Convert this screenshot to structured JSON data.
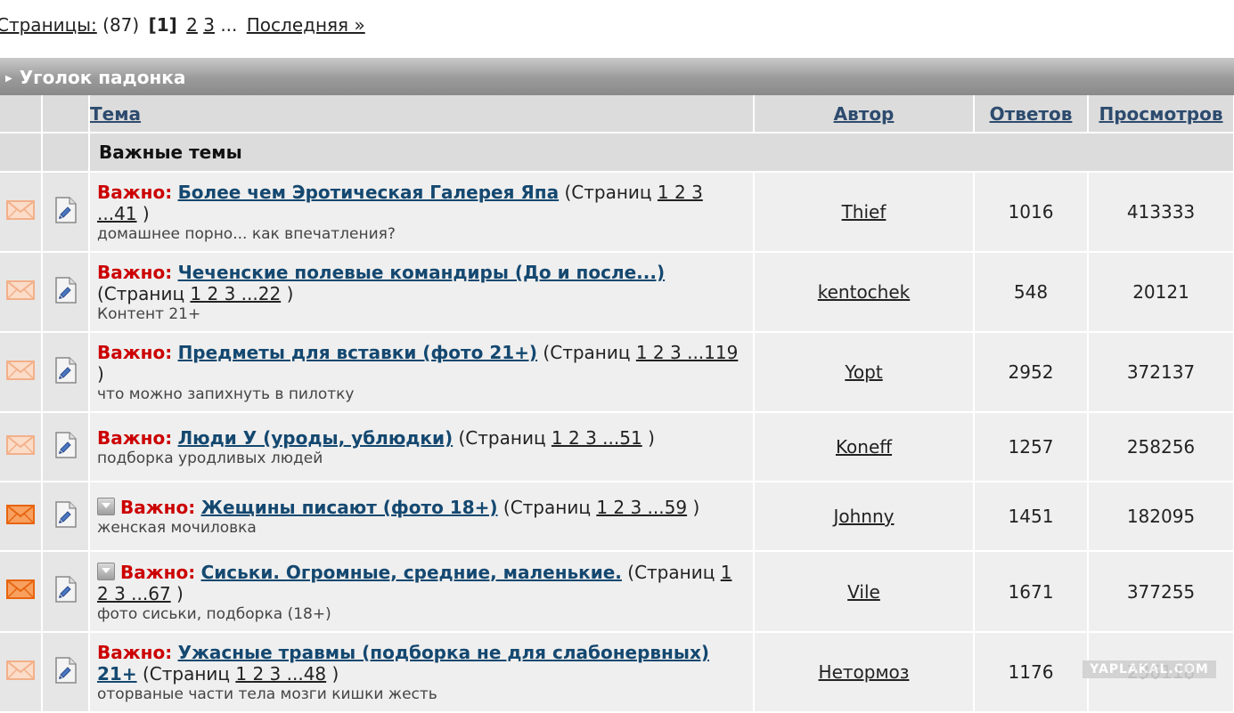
{
  "pager": {
    "label": "Страницы:",
    "count": "(87)",
    "current": "[1]",
    "p2": "2",
    "p3": "3",
    "ellipsis": "...",
    "last": "Последняя »"
  },
  "forum": {
    "title": "Уголок падонка"
  },
  "columns": {
    "topic": "Тема",
    "author": "Автор",
    "replies": "Ответов",
    "views": "Просмотров"
  },
  "section": {
    "label": "Важные темы"
  },
  "important_label": "Важно:",
  "pages_word": "(Страниц",
  "close_paren": ")",
  "topics": [
    {
      "title": "Более чем Эротическая Галерея Япа",
      "pages": "1 2 3 ...41",
      "desc": "домашнее порно... как впечатления?",
      "author": "Thief",
      "replies": "1016",
      "views": "413333"
    },
    {
      "title": "Чеченские полевые командиры (До и после...)",
      "pages": "1 2 3 ...22",
      "desc": "Контент 21+",
      "author": "kentochek",
      "replies": "548",
      "views": "20121"
    },
    {
      "title": "Предметы для вставки (фото 21+)",
      "pages": "1 2 3 ...119",
      "desc": "что можно запихнуть в пилотку",
      "author": "Yopt",
      "replies": "2952",
      "views": "372137"
    },
    {
      "title": "Люди У (уроды, ублюдки)",
      "pages": "1 2 3 ...51",
      "desc": "подборка уродливых людей",
      "author": "Koneff",
      "replies": "1257",
      "views": "258256"
    },
    {
      "title": "Жещины писают (фото 18+)",
      "pages": "1 2 3 ...59",
      "desc": "женская мочиловка",
      "author": "Johnny",
      "replies": "1451",
      "views": "182095"
    },
    {
      "title": "Сиськи. Огромные, средние, маленькие.",
      "pages": "1 2 3 ...67",
      "desc": "фото сиськи, подборка (18+)",
      "author": "Vile",
      "replies": "1671",
      "views": "377255"
    },
    {
      "title": "Ужасные травмы (подборка не для слабонервных) 21+",
      "pages": "1 2 3 ...48",
      "desc": "оторваные части тела мозги кишки жесть",
      "author": "Нетормоз",
      "replies": "1176",
      "views": "236118"
    }
  ],
  "watermark": "YAPLAKAL.COM",
  "colors": {
    "important": "#cc0000",
    "title_link": "#144870",
    "header_bar": "#9a9a9a",
    "row_bg": "#efefef"
  }
}
